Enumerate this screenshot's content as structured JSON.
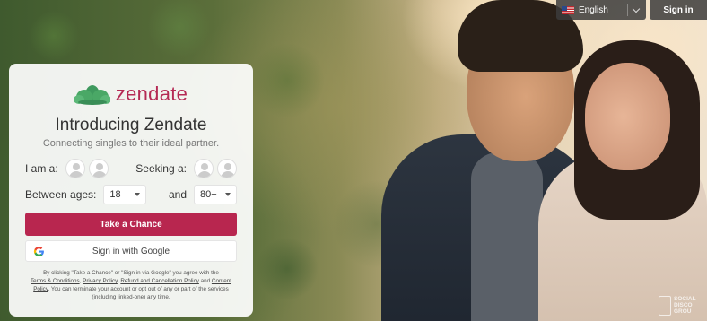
{
  "header": {
    "language": "English",
    "signin_label": "Sign in"
  },
  "card": {
    "brand": "zendate",
    "headline": "Introducing Zendate",
    "subline": "Connecting singles to their ideal partner.",
    "i_am_label": "I am a:",
    "seeking_label": "Seeking a:",
    "between_label": "Between ages:",
    "and_label": "and",
    "min_age": "18",
    "max_age": "80+",
    "primary_button": "Take a Chance",
    "google_button": "Sign in with Google",
    "legal": {
      "intro": "By clicking \"Take a Chance\" or \"Sign in via Google\" you agree with the",
      "terms": "Terms & Conditions",
      "sep1": ",",
      "privacy": "Privacy Policy",
      "sep2": ",",
      "refund": "Refund and Cancellation Policy",
      "and": "and",
      "content": "Content Policy",
      "tail": ". You can terminate your account or opt out of any or part of the services (including linked-one) any time."
    }
  },
  "badge": {
    "line1": "SOCIAL",
    "line2": "DISCO",
    "line3": "GROU"
  },
  "colors": {
    "brand": "#b52a55",
    "primary_button": "#b8264f"
  }
}
